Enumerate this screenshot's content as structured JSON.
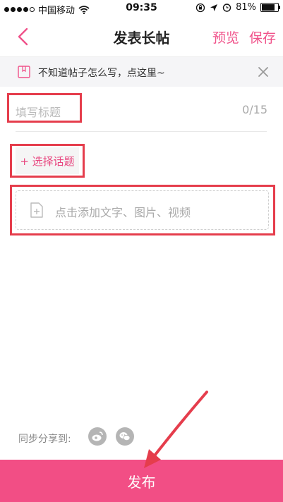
{
  "status_bar": {
    "carrier": "中国移动",
    "time": "09:35",
    "battery": "81%",
    "battery_level": 0.81
  },
  "nav": {
    "title": "发表长帖",
    "preview": "预览",
    "save": "保存"
  },
  "tip": {
    "text": "不知道帖子怎么写，点这里~"
  },
  "post_title": {
    "placeholder": "填写标题",
    "counter": "0/15"
  },
  "topic": {
    "label": "+ 选择话题"
  },
  "content": {
    "placeholder": "点击添加文字、图片、视频"
  },
  "share": {
    "label": "同步分享到:",
    "targets": [
      "weibo-icon",
      "wechat-icon"
    ]
  },
  "publish": {
    "label": "发布"
  },
  "colors": {
    "accent": "#f24e85",
    "highlight": "#e53d4c"
  }
}
